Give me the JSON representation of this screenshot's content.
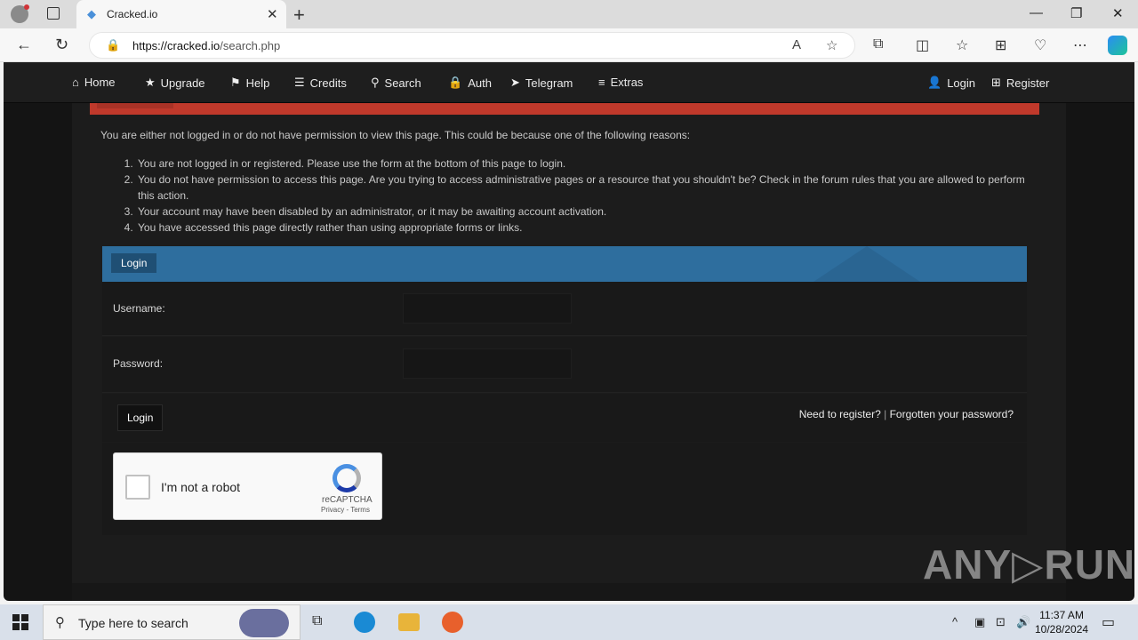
{
  "browser": {
    "tab_title": "Cracked.io",
    "url_host": "https://cracked.io",
    "url_path": "/search.php"
  },
  "site_nav": {
    "items": [
      {
        "label": "Home",
        "icon": "home-icon",
        "glyph": "⌂"
      },
      {
        "label": "Upgrade",
        "icon": "star-icon",
        "glyph": "★"
      },
      {
        "label": "Help",
        "icon": "flag-icon",
        "glyph": "⚑"
      },
      {
        "label": "Credits",
        "icon": "coins-icon",
        "glyph": "☰"
      },
      {
        "label": "Search",
        "icon": "search-icon",
        "glyph": "⚲"
      },
      {
        "label": "Auth",
        "icon": "lock-icon",
        "glyph": "🔒"
      },
      {
        "label": "Telegram",
        "icon": "telegram-icon",
        "glyph": "➤"
      },
      {
        "label": "Extras",
        "icon": "menu-icon",
        "glyph": "≡"
      }
    ],
    "login": "Login",
    "register": "Register"
  },
  "error": {
    "notice": "You are either not logged in or do not have permission to view this page. This could be because one of the following reasons:",
    "reasons": [
      "You are not logged in or registered. Please use the form at the bottom of this page to login.",
      "You do not have permission to access this page. Are you trying to access administrative pages or a resource that you shouldn't be? Check in the forum rules that you are allowed to perform this action.",
      "Your account may have been disabled by an administrator, or it may be awaiting account activation.",
      "You have accessed this page directly rather than using appropriate forms or links."
    ]
  },
  "login_form": {
    "header": "Login",
    "username_label": "Username:",
    "password_label": "Password:",
    "submit_label": "Login",
    "need_register": "Need to register?",
    "separator": "|",
    "forgot_password": "Forgotten your password?"
  },
  "captcha": {
    "label": "I'm not a robot",
    "brand": "reCAPTCHA",
    "privacy_terms": "Privacy - Terms"
  },
  "watermark": "ANY▷RUN",
  "taskbar": {
    "search_placeholder": "Type here to search",
    "time": "11:37 AM",
    "date": "10/28/2024"
  },
  "colors": {
    "accent_red": "#c0392b",
    "login_header_blue": "#2e6e9e",
    "page_bg": "#141414"
  }
}
